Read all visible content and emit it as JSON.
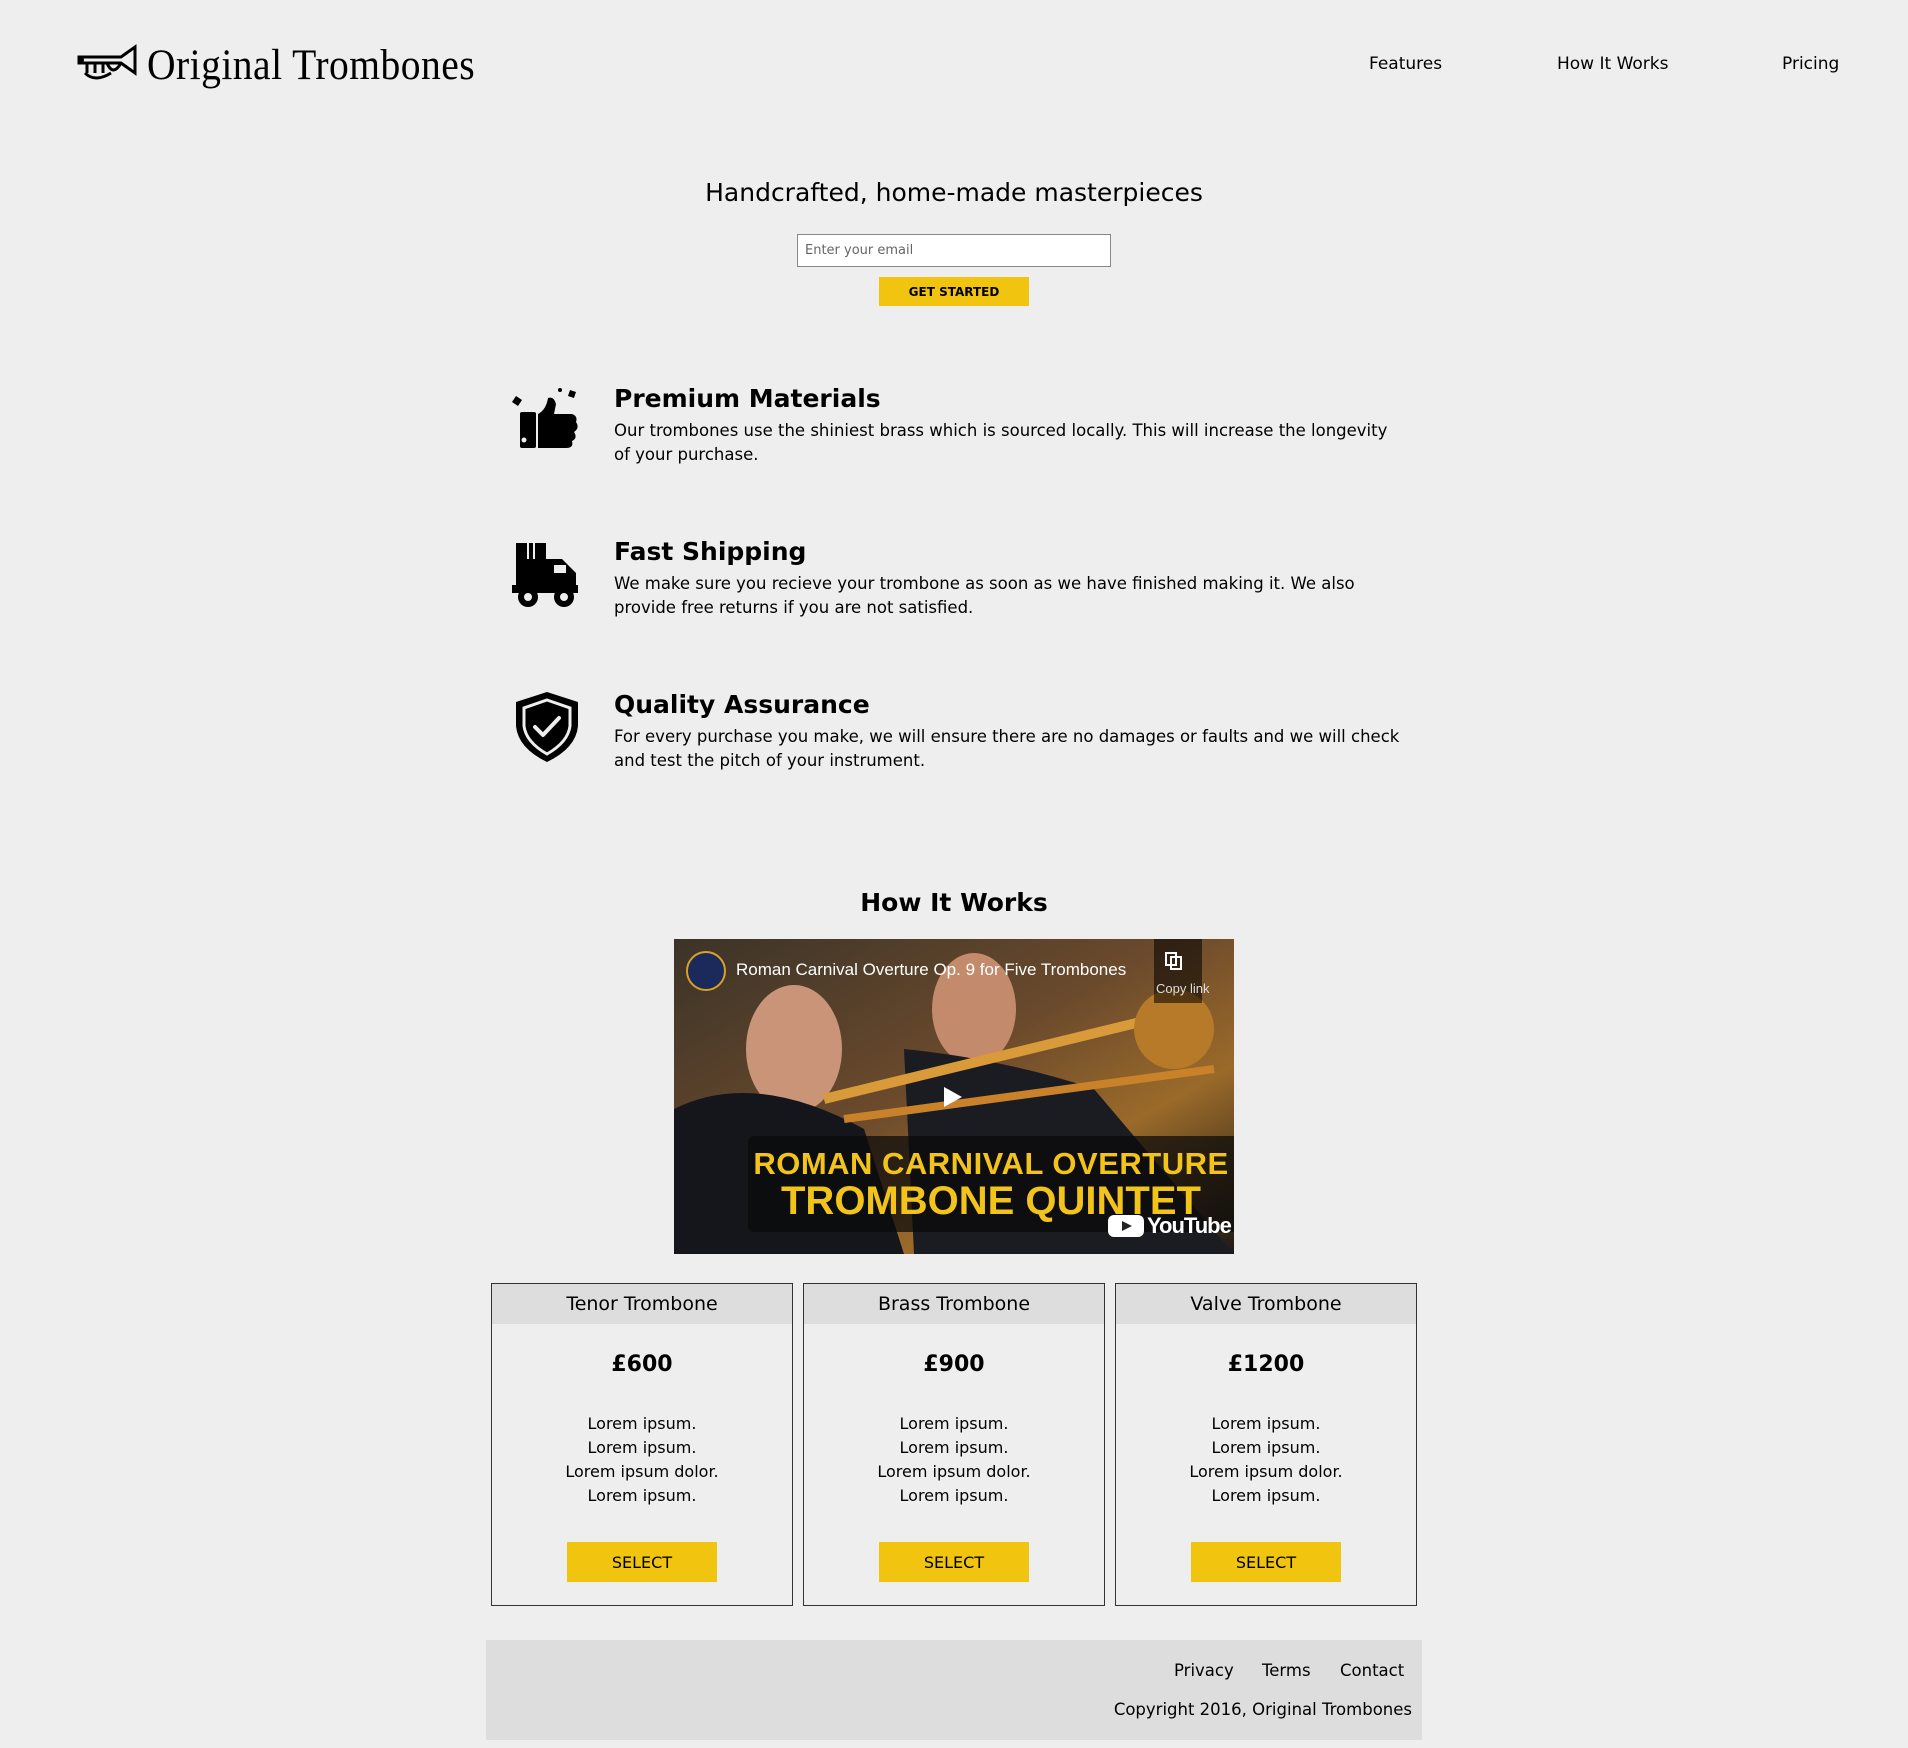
{
  "brand": {
    "name": "Original Trombones",
    "icon": "trumpet-icon"
  },
  "nav": {
    "items": [
      {
        "label": "Features"
      },
      {
        "label": "How It Works"
      },
      {
        "label": "Pricing"
      }
    ]
  },
  "hero": {
    "title": "Handcrafted, home-made masterpieces",
    "email_placeholder": "Enter your email",
    "cta_label": "GET STARTED"
  },
  "features": [
    {
      "icon": "thumbs-up-icon",
      "title": "Premium Materials",
      "description": "Our trombones use the shiniest brass which is sourced locally. This will increase the longevity of your purchase."
    },
    {
      "icon": "truck-icon",
      "title": "Fast Shipping",
      "description": "We make sure you recieve your trombone as soon as we have finished making it. We also provide free returns if you are not satisfied."
    },
    {
      "icon": "shield-check-icon",
      "title": "Quality Assurance",
      "description": "For every purchase you make, we will ensure there are no damages or faults and we will check and test the pitch of your instrument."
    }
  ],
  "how_it_works": {
    "title": "How It Works",
    "video": {
      "title": "Roman Carnival Overture Op. 9 for Five Trombones",
      "copy_link_label": "Copy link",
      "banner_line1": "ROMAN CARNIVAL OVERTURE",
      "banner_line2": "TROMBONE QUINTET",
      "platform": "YouTube"
    }
  },
  "pricing": {
    "plans": [
      {
        "name": "Tenor Trombone",
        "price": "£600",
        "features": [
          "Lorem ipsum.",
          "Lorem ipsum.",
          "Lorem ipsum dolor.",
          "Lorem ipsum."
        ],
        "button": "SELECT"
      },
      {
        "name": "Brass Trombone",
        "price": "£900",
        "features": [
          "Lorem ipsum.",
          "Lorem ipsum.",
          "Lorem ipsum dolor.",
          "Lorem ipsum."
        ],
        "button": "SELECT"
      },
      {
        "name": "Valve Trombone",
        "price": "£1200",
        "features": [
          "Lorem ipsum.",
          "Lorem ipsum.",
          "Lorem ipsum dolor.",
          "Lorem ipsum."
        ],
        "button": "SELECT"
      }
    ]
  },
  "footer": {
    "links": [
      {
        "label": "Privacy"
      },
      {
        "label": "Terms"
      },
      {
        "label": "Contact"
      }
    ],
    "copyright": "Copyright 2016, Original Trombones"
  },
  "colors": {
    "background": "#eeeeee",
    "accent": "#f1c40f",
    "panel": "#dddddd",
    "text": "#000000"
  }
}
